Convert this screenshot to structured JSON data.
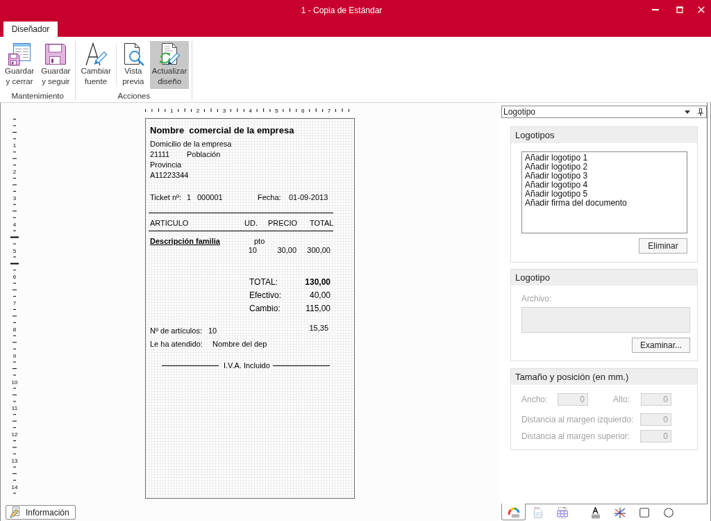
{
  "window": {
    "title": "1 - Copia de Estándar"
  },
  "ribbon": {
    "tabs": [
      {
        "label": "Diseñador",
        "selected": true
      }
    ],
    "groups": [
      {
        "label": "Mantenimiento",
        "buttons": [
          {
            "lines": [
              "Guardar",
              "y cerrar"
            ],
            "selected": false,
            "separator_after": false
          },
          {
            "lines": [
              "Guardar",
              "y seguir"
            ],
            "selected": false,
            "separator_after": false
          }
        ]
      },
      {
        "label": "Acciones",
        "buttons": [
          {
            "lines": [
              "Cambiar",
              "fuente"
            ],
            "selected": false,
            "separator_after": true
          },
          {
            "lines": [
              "Vista",
              "previa"
            ],
            "selected": false,
            "separator_after": false
          },
          {
            "lines": [
              "Actualizar",
              "diseño"
            ],
            "selected": true,
            "separator_after": false
          }
        ]
      }
    ]
  },
  "rulers": {
    "horizontal": [
      "1",
      "2",
      "3",
      "4",
      "5",
      "6",
      "7"
    ],
    "vertical": [
      "1",
      "2",
      "3",
      "4",
      "5",
      "6",
      "7",
      "8",
      "9",
      "10",
      "11",
      "12",
      "13",
      "14"
    ]
  },
  "ticket": {
    "company_name": "Nombre  comercial de la empresa",
    "address": "Domicilio de la empresa",
    "postal_code": "21111",
    "city": "Población",
    "province": "Provincia",
    "tax_id": "A11223344",
    "ticket_label": "Ticket nº:",
    "series": "1",
    "number": "000001",
    "date_label": "Fecha:",
    "date": "01-09-2013",
    "columns": [
      "ARTICULO",
      "UD.",
      "PRECIO",
      "TOTAL"
    ],
    "family": "Descripción familia",
    "unit": "pto",
    "line": {
      "quantity": "10",
      "price": "30,00",
      "total": "300,00"
    },
    "totals": [
      {
        "label": "TOTAL:",
        "value": "130,00",
        "emphasized": true
      },
      {
        "label": "Efectivo:",
        "value": "40,00",
        "emphasized": false
      },
      {
        "label": "Cambio:",
        "value": "115,00",
        "emphasized": false
      }
    ],
    "unlabeled_amount": "15,35",
    "item_count_label": "Nº de artículos:",
    "item_count": "10",
    "served_by_label": "Le ha atendido:",
    "served_by": "Nombre del dep",
    "footer": "I.V.A. Incluido"
  },
  "info_button": {
    "label": "Información"
  },
  "properties_panel": {
    "selector": {
      "value": "Logotipo"
    },
    "logos_group": {
      "title": "Logotipos",
      "items": [
        {
          "label": "Añadir logotipo 1",
          "selected": false
        },
        {
          "label": "Añadir logotipo 2",
          "selected": false
        },
        {
          "label": "Añadir logotipo 3",
          "selected": false
        },
        {
          "label": "Añadir logotipo 4",
          "selected": false
        },
        {
          "label": "Añadir logotipo 5",
          "selected": false
        },
        {
          "label": "Añadir firma del documento",
          "selected": false
        }
      ],
      "delete_button": "Eliminar"
    },
    "logo_group": {
      "title": "Logotipo",
      "file_label": "Archivo:",
      "file_disabled": true,
      "browse_button": "Examinar..."
    },
    "size_group": {
      "title": "Tamaño y posición (en mm.)",
      "rows": [
        {
          "fields": [
            {
              "label": "Ancho:",
              "value": "0",
              "disabled": true
            },
            {
              "label": "Alto:",
              "value": "0",
              "disabled": true
            }
          ]
        },
        {
          "fields": [
            {
              "label": "Distancia al margen izquierdo:",
              "value": "0",
              "disabled": true
            }
          ]
        },
        {
          "fields": [
            {
              "label": "Distancia al margen superior:",
              "value": "0",
              "disabled": true
            }
          ]
        }
      ]
    },
    "tabs": [
      {
        "selected": true
      },
      {
        "selected": false
      },
      {
        "selected": false
      },
      {
        "selected": false
      },
      {
        "selected": false
      },
      {
        "selected": false
      },
      {
        "selected": false
      }
    ]
  }
}
